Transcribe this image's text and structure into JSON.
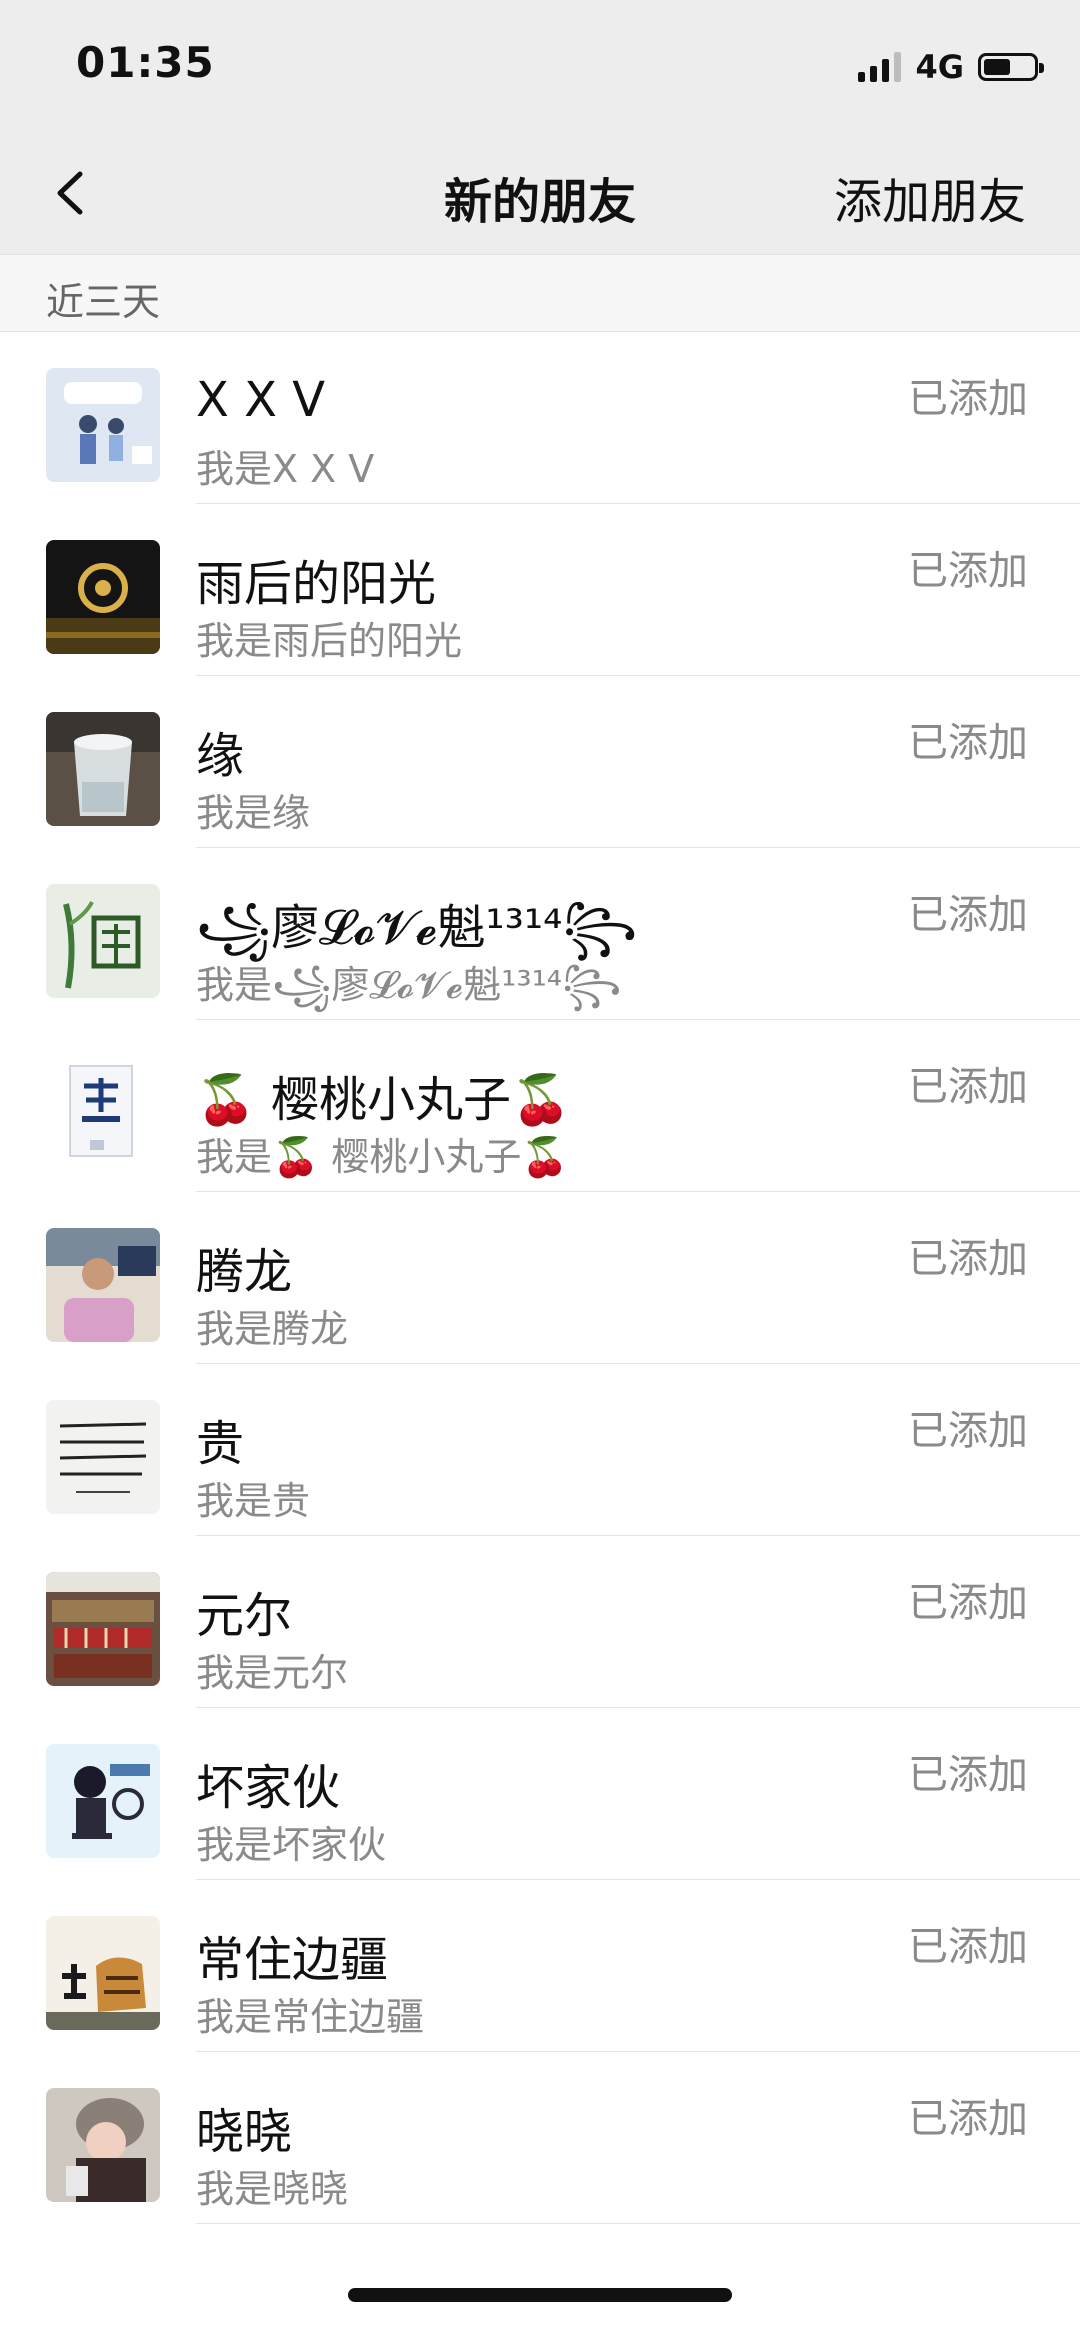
{
  "status_bar": {
    "time": "01:35",
    "network": "4G",
    "battery_level": 0.55,
    "icons": [
      "signal-icon",
      "battery-icon"
    ]
  },
  "nav": {
    "title": "新的朋友",
    "action": "添加朋友",
    "back_icon": "chevron-left-icon"
  },
  "section": {
    "title": "近三天"
  },
  "friends": [
    {
      "name": "X X V",
      "message": "我是X X V",
      "status": "已添加"
    },
    {
      "name": "雨后的阳光",
      "message": "我是雨后的阳光",
      "status": "已添加"
    },
    {
      "name": "缘",
      "message": "我是缘",
      "status": "已添加"
    },
    {
      "name": "꧁廖𝓛𝓸𝓥𝓮魁¹³¹⁴꧂",
      "message": "我是꧁廖𝓛𝓸𝓥𝓮魁¹³¹⁴꧂",
      "status": "已添加"
    },
    {
      "name": "🍒  樱桃小丸子🍒",
      "message": "我是🍒  樱桃小丸子🍒",
      "status": "已添加"
    },
    {
      "name": "腾龙",
      "message": "我是腾龙",
      "status": "已添加"
    },
    {
      "name": "贵",
      "message": "我是贵",
      "status": "已添加"
    },
    {
      "name": "元尔",
      "message": "我是元尔",
      "status": "已添加"
    },
    {
      "name": "坏家伙",
      "message": "我是坏家伙",
      "status": "已添加"
    },
    {
      "name": "常住边疆",
      "message": "我是常住边疆",
      "status": "已添加"
    },
    {
      "name": "晓晓",
      "message": "我是晓晓",
      "status": "已添加"
    }
  ]
}
